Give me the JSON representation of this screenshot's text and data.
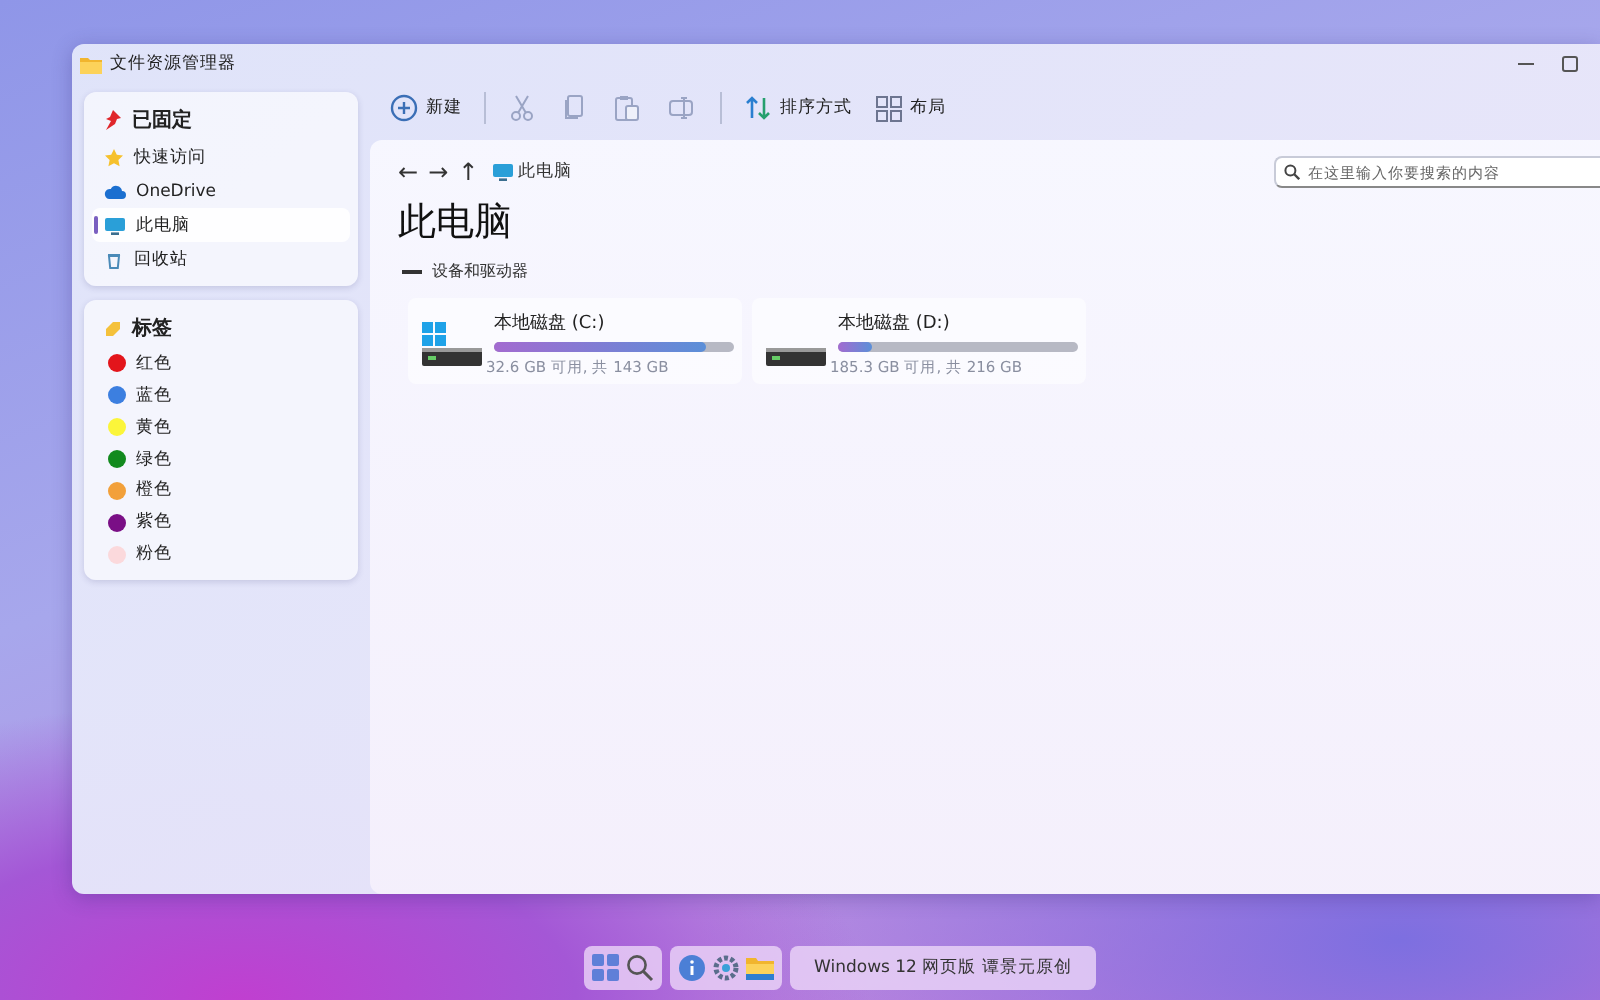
{
  "window": {
    "title": "文件资源管理器"
  },
  "sidebar": {
    "pinned": {
      "heading": "已固定",
      "items": [
        {
          "label": "快速访问",
          "selected": false
        },
        {
          "label": "OneDrive",
          "selected": false
        },
        {
          "label": "此电脑",
          "selected": true
        },
        {
          "label": "回收站",
          "selected": false
        }
      ]
    },
    "tags": {
      "heading": "标签",
      "items": [
        {
          "label": "红色",
          "color": "#e3151b"
        },
        {
          "label": "蓝色",
          "color": "#3c7fe0"
        },
        {
          "label": "黄色",
          "color": "#fbf53a"
        },
        {
          "label": "绿色",
          "color": "#128a1e"
        },
        {
          "label": "橙色",
          "color": "#f2a03a"
        },
        {
          "label": "紫色",
          "color": "#7a0f86"
        },
        {
          "label": "粉色",
          "color": "#fbd9dc"
        }
      ]
    }
  },
  "toolbar": [
    {
      "kind": "new",
      "label": "新建"
    },
    {
      "kind": "separator"
    },
    {
      "kind": "cut",
      "disabled": true
    },
    {
      "kind": "copy",
      "disabled": true
    },
    {
      "kind": "paste",
      "disabled": true
    },
    {
      "kind": "rename",
      "disabled": true
    },
    {
      "kind": "separator"
    },
    {
      "kind": "sort",
      "label": "排序方式"
    },
    {
      "kind": "layout",
      "label": "布局"
    }
  ],
  "address": {
    "buttons": [
      "←",
      "→",
      "↑"
    ],
    "location": "此电脑"
  },
  "search": {
    "placeholder": "在这里输入你要搜索的内容"
  },
  "page_title": "此电脑",
  "section": {
    "title": "设备和驱动器",
    "expanded": true
  },
  "drives": [
    {
      "name": "本地磁盘 (C:)",
      "kind": "system",
      "level": 0.88,
      "details": "32.6 GB 可用, 共 143 GB"
    },
    {
      "name": "本地磁盘 (D:)",
      "kind": "data",
      "level": 0.14,
      "details": "185.3 GB 可用, 共 216 GB"
    }
  ],
  "taskbar": {
    "label": "Windows 12 网页版 谭景元原创"
  }
}
